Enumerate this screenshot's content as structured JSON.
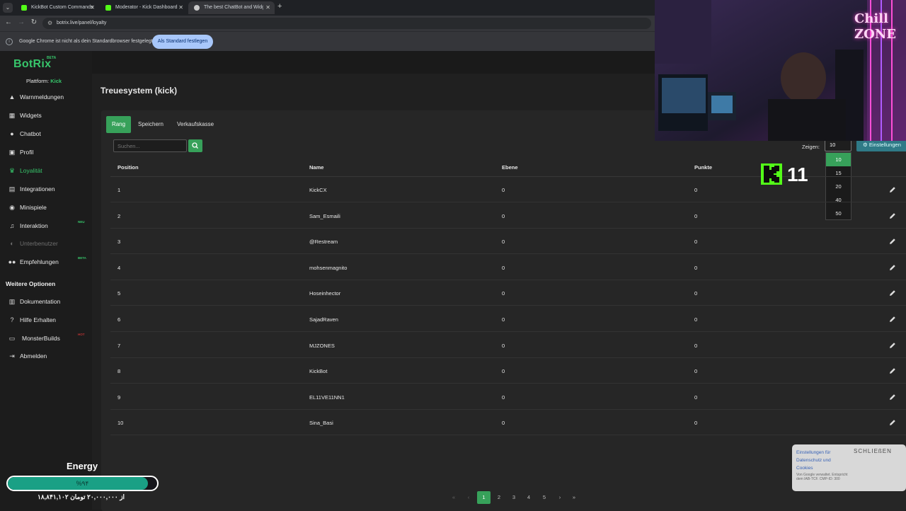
{
  "browser": {
    "tabs": [
      {
        "title": "KickBot Custom Commands",
        "active": false
      },
      {
        "title": "Moderator - Kick Dashboard",
        "active": false
      },
      {
        "title": "The best ChatBot and Widgets",
        "active": true
      }
    ],
    "url": "botrix.live/panel/loyalty",
    "infobar_text": "Google Chrome ist nicht als dein Standardbrowser festgelegt",
    "infobar_button": "Als Standard festlegen"
  },
  "app": {
    "logo": "BotRix",
    "logo_badge": "BETA",
    "platform_label": "Plattform:",
    "platform_value": "Kick",
    "accent": "#37a15a"
  },
  "sidebar": {
    "items": [
      {
        "label": "Warnmeldungen",
        "icon": "bell-icon",
        "active": false
      },
      {
        "label": "Widgets",
        "icon": "grid-icon",
        "active": false
      },
      {
        "label": "Chatbot",
        "icon": "robot-icon",
        "active": false
      },
      {
        "label": "Profil",
        "icon": "id-card-icon",
        "active": false
      },
      {
        "label": "Loyalität",
        "icon": "trophy-icon",
        "active": true
      },
      {
        "label": "Integrationen",
        "icon": "plug-icon",
        "active": false
      },
      {
        "label": "Minispiele",
        "icon": "gamepad-icon",
        "active": false
      },
      {
        "label": "Interaktion",
        "icon": "music-icon",
        "active": false,
        "badge": "NEU"
      },
      {
        "label": "Unterbenutzer",
        "icon": "user-icon",
        "active": false,
        "disabled": true
      },
      {
        "label": "Empfehlungen",
        "icon": "users-icon",
        "active": false,
        "badge": "BETA"
      }
    ],
    "section_title": "Weitere Optionen",
    "more_items": [
      {
        "label": "Dokumentation",
        "icon": "book-icon"
      },
      {
        "label": "Hilfe Erhalten",
        "icon": "question-icon"
      },
      {
        "label": "MonsterBuilds",
        "icon": "laptop-icon",
        "badge": "HOT"
      },
      {
        "label": "Abmelden",
        "icon": "logout-icon"
      }
    ]
  },
  "main": {
    "title": "Treuesystem (kick)",
    "tabs": [
      "Rang",
      "Speichern",
      "Verkaufskasse"
    ],
    "search_placeholder": "Suchen...",
    "show_label": "Zeigen:",
    "show_value": "10",
    "show_options": [
      "10",
      "15",
      "20",
      "40",
      "50"
    ],
    "settings_label": "Einstellungen",
    "columns": [
      "Position",
      "Name",
      "Ebene",
      "Punkte"
    ],
    "rows": [
      {
        "position": "1",
        "name": "KickCX",
        "level": "0",
        "points": "0"
      },
      {
        "position": "2",
        "name": "Sam_Esmaili",
        "level": "0",
        "points": "0"
      },
      {
        "position": "3",
        "name": "@Restream",
        "level": "0",
        "points": "0"
      },
      {
        "position": "4",
        "name": "mohsenmagnito",
        "level": "0",
        "points": "0"
      },
      {
        "position": "5",
        "name": "Hoseinhector",
        "level": "0",
        "points": "0"
      },
      {
        "position": "6",
        "name": "SajadRaven",
        "level": "0",
        "points": "0"
      },
      {
        "position": "7",
        "name": "MJZONES",
        "level": "0",
        "points": "0"
      },
      {
        "position": "8",
        "name": "KickBot",
        "level": "0",
        "points": "0"
      },
      {
        "position": "9",
        "name": "EL11VE11NN1",
        "level": "0",
        "points": "0"
      },
      {
        "position": "10",
        "name": "Sina_Basi",
        "level": "0",
        "points": "0"
      }
    ],
    "pagination": {
      "first": "«",
      "prev": "‹",
      "pages": [
        "1",
        "2",
        "3",
        "4",
        "5"
      ],
      "current": "1",
      "next": "›",
      "last": "»"
    }
  },
  "overlay": {
    "kick_count": "11",
    "neon_sign": "Chill ZONE",
    "cookie_title": "Einstellungen für Datenschutz und Cookies",
    "cookie_close": "SCHLIEßEN",
    "cookie_note": "Von Google verwaltet. Entspricht dem IAB-TCF. CMP-ID: 300",
    "energy_label": "Energy",
    "energy_percent_text": "%۹۴",
    "energy_fraction": 0.94,
    "energy_amount": "۱۸,۸۴۱,۱۰۲ از ۲۰,۰۰۰,۰۰۰ تومان"
  }
}
